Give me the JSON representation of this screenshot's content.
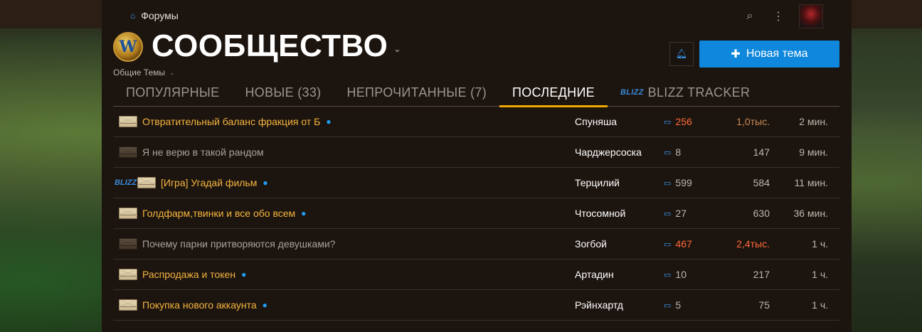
{
  "breadcrumb": {
    "label": "Форумы"
  },
  "header": {
    "title": "СООБЩЕСТВО",
    "subtitle": "Общие Темы",
    "logo_letter": "W",
    "new_topic_label": "Новая тема"
  },
  "tabs": [
    {
      "label": "ПОПУЛЯРНЫЕ",
      "active": false
    },
    {
      "label": "НОВЫЕ (33)",
      "active": false
    },
    {
      "label": "НЕПРОЧИТАННЫЕ (7)",
      "active": false
    },
    {
      "label": "ПОСЛЕДНИЕ",
      "active": true
    },
    {
      "label": "BLIZZ TRACKER",
      "active": false,
      "icon": "blizz-icon"
    }
  ],
  "icons": {
    "home": "⌂",
    "search": "⌕",
    "menu": "⋮",
    "bell": "🔔",
    "plus": "✚",
    "reply": "💬",
    "blizz": "BLIZZ"
  },
  "colors": {
    "accent": "#f0a800",
    "primary_button": "#0e87dc",
    "topic_unread": "#f5b53f",
    "topic_read": "#a9a29a",
    "hot": "#ff6a3a",
    "unread_dot": "#1e9ef0"
  },
  "topics": [
    {
      "title": "Отвратительный баланс фракция от Б",
      "unread": true,
      "read": false,
      "blizz": false,
      "author": "Спуняша",
      "replies": "256",
      "replies_hot": true,
      "views": "1,0тыс.",
      "views_level": "warm",
      "activity": "2 мин."
    },
    {
      "title": "Я не верю в такой рандом",
      "unread": false,
      "read": true,
      "blizz": false,
      "author": "Чарджерсоска",
      "replies": "8",
      "replies_hot": false,
      "views": "147",
      "views_level": "normal",
      "activity": "9 мин."
    },
    {
      "title": "[Игра] Угадай фильм",
      "unread": true,
      "read": false,
      "blizz": true,
      "author": "Терцилий",
      "replies": "599",
      "replies_hot": false,
      "views": "584",
      "views_level": "normal",
      "activity": "11 мин."
    },
    {
      "title": "Голдфарм,твинки и все обо всем",
      "unread": true,
      "read": false,
      "blizz": false,
      "author": "Чтосомной",
      "replies": "27",
      "replies_hot": false,
      "views": "630",
      "views_level": "normal",
      "activity": "36 мин."
    },
    {
      "title": "Почему парни притворяются девушками?",
      "unread": false,
      "read": true,
      "blizz": false,
      "author": "Зогбой",
      "replies": "467",
      "replies_hot": true,
      "views": "2,4тыс.",
      "views_level": "hot",
      "activity": "1 ч."
    },
    {
      "title": "Распродажа и токен",
      "unread": true,
      "read": false,
      "blizz": false,
      "author": "Артадин",
      "replies": "10",
      "replies_hot": false,
      "views": "217",
      "views_level": "normal",
      "activity": "1 ч."
    },
    {
      "title": "Покупка нового аккаунта",
      "unread": true,
      "read": false,
      "blizz": false,
      "author": "Рэйнхартд",
      "replies": "5",
      "replies_hot": false,
      "views": "75",
      "views_level": "normal",
      "activity": "1 ч."
    }
  ]
}
